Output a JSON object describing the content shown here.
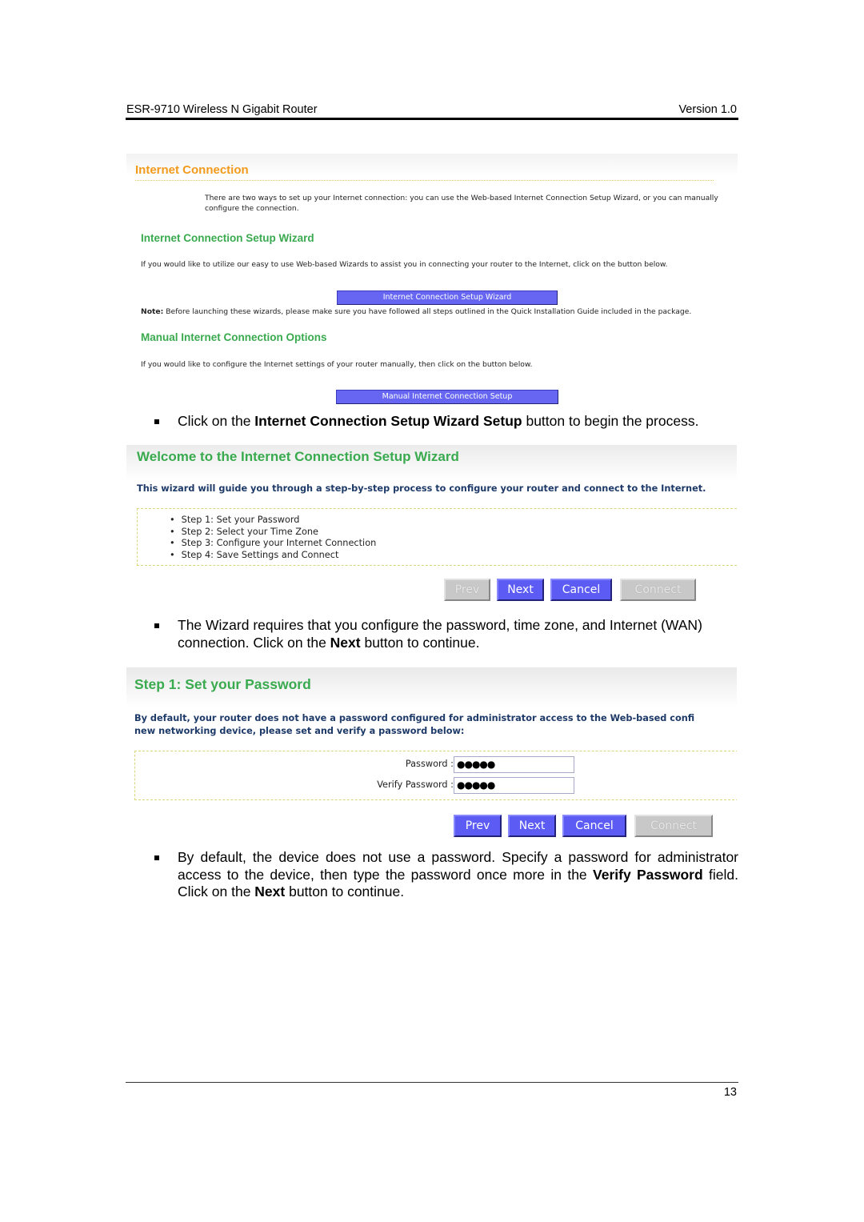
{
  "header": {
    "product": "ESR-9710 Wireless N Gigabit Router",
    "version": "Version 1.0"
  },
  "footer": {
    "page_number": "13"
  },
  "screenshot_internet_connection": {
    "title": "Internet Connection",
    "intro": "There are two ways to set up your Internet connection: you can use the Web-based Internet Connection Setup Wizard, or you can manually configure the connection.",
    "wizard_heading": "Internet Connection Setup Wizard",
    "wizard_text": "If you would like to utilize our easy to use Web-based Wizards to assist you in connecting your router to the Internet, click on the button below.",
    "wizard_button": "Internet Connection Setup Wizard",
    "note_label": "Note:",
    "note_text": " Before launching these wizards, please make sure you have followed all steps outlined in the Quick Installation Guide included in the package.",
    "manual_heading": "Manual Internet Connection Options",
    "manual_text": "If you would like to configure the Internet settings of your router manually, then click on the button below.",
    "manual_button": "Manual Internet Connection Setup"
  },
  "bullet1": {
    "pre": "Click on the ",
    "bold": "Internet Connection Setup Wizard Setup",
    "post": " button to begin the process."
  },
  "screenshot_welcome": {
    "title": "Welcome to the Internet Connection Setup Wizard",
    "description": "This wizard will guide you through a step-by-step process to configure your router and connect to the Internet.",
    "steps": [
      "Step 1: Set your Password",
      "Step 2: Select your Time Zone",
      "Step 3: Configure your Internet Connection",
      "Step 4: Save Settings and Connect"
    ],
    "buttons": {
      "prev": "Prev",
      "next": "Next",
      "cancel": "Cancel",
      "connect": "Connect"
    }
  },
  "bullet2": {
    "pre": "The Wizard requires that you configure the password, time zone, and Internet (WAN) connection. Click on the ",
    "bold": "Next",
    "post": " button to continue."
  },
  "screenshot_password": {
    "title": "Step 1: Set your Password",
    "description_line1": "By default, your router does not have a password configured for administrator access to the Web-based confi",
    "description_line2": "new networking device, please set and verify a password below:",
    "password_label": "Password :",
    "password_value": "●●●●●",
    "verify_label": "Verify Password :",
    "verify_value": "●●●●●",
    "buttons": {
      "prev": "Prev",
      "next": "Next",
      "cancel": "Cancel",
      "connect": "Connect"
    }
  },
  "bullet3": {
    "pre": "By default, the device does not use a password. Specify a password for administrator access to the device, then type the password once more in the ",
    "bold1": "Verify Password",
    "mid": " field.  Click on the ",
    "bold2": "Next",
    "post": " button to continue."
  },
  "colors": {
    "orange_heading": "#f29a1c",
    "green_heading": "#3aaa4f",
    "button_blue": "#5c5cf5",
    "button_disabled": "#c8c8c8",
    "navy_text": "#1e3a68"
  }
}
